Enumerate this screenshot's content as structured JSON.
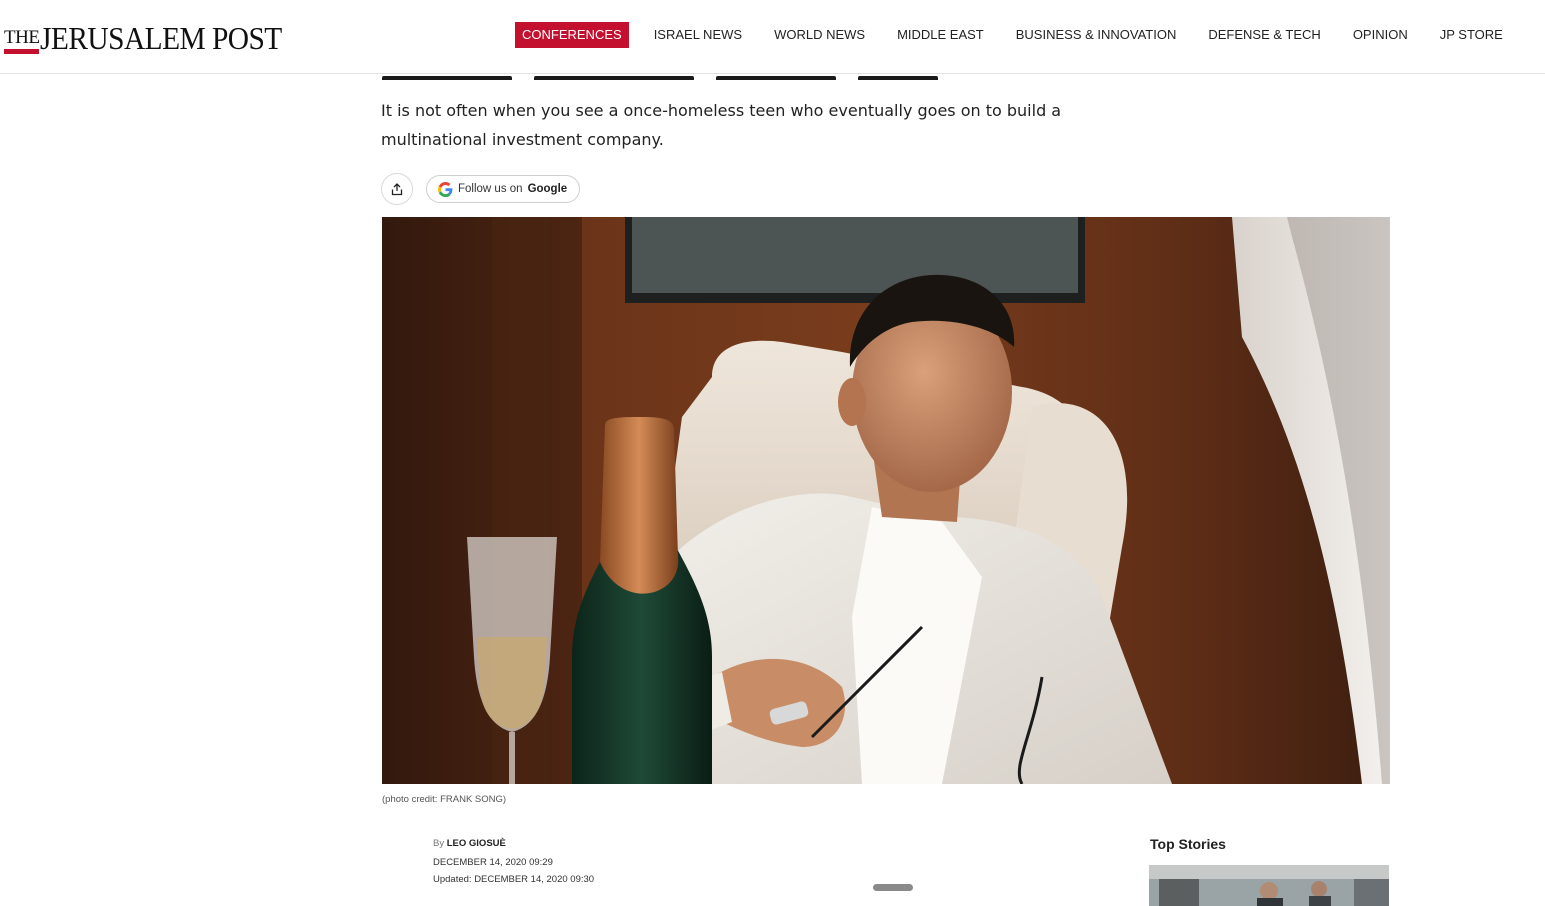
{
  "header": {
    "logo_the": "THE",
    "logo_name": "JERUSALEM POST",
    "nav": [
      {
        "label": "CONFERENCES",
        "active": true
      },
      {
        "label": "ISRAEL NEWS"
      },
      {
        "label": "WORLD NEWS"
      },
      {
        "label": "MIDDLE EAST"
      },
      {
        "label": "BUSINESS & INNOVATION"
      },
      {
        "label": "DEFENSE & TECH"
      },
      {
        "label": "OPINION"
      },
      {
        "label": "JP STORE"
      }
    ]
  },
  "article": {
    "subheadline": "It is not often when you see a once-homeless teen who eventually goes on to build a multinational investment company.",
    "share_icon": "share-icon",
    "follow": {
      "prefix": "Follow us on",
      "brand": "Google",
      "icon": "google-g-icon"
    },
    "photo_credit": "(photo credit: FRANK SONG)",
    "byline_prefix": "By",
    "author": "LEO GIOSUÈ",
    "published": "DECEMBER 14, 2020 09:29",
    "updated": "Updated: DECEMBER 14, 2020 09:30"
  },
  "sidebar": {
    "top_stories_title": "Top Stories"
  },
  "colors": {
    "brand_red": "#c4102f"
  }
}
